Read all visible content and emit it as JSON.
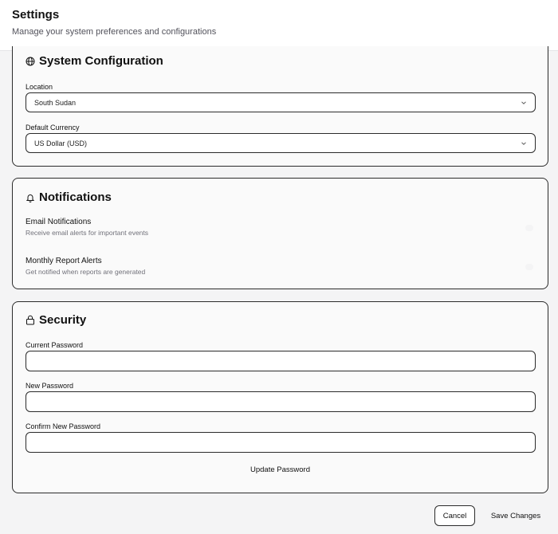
{
  "header": {
    "title": "Settings",
    "subtitle": "Manage your system preferences and configurations"
  },
  "system": {
    "heading": "System Configuration",
    "icon": "globe-icon",
    "location_label": "Location",
    "location_value": "South Sudan",
    "currency_label": "Default Currency",
    "currency_value": "US Dollar (USD)"
  },
  "notifications": {
    "heading": "Notifications",
    "icon": "bell-icon",
    "items": [
      {
        "title": "Email Notifications",
        "description": "Receive email alerts for important events"
      },
      {
        "title": "Monthly Report Alerts",
        "description": "Get notified when reports are generated"
      }
    ]
  },
  "security": {
    "heading": "Security",
    "icon": "lock-icon",
    "current_label": "Current Password",
    "new_label": "New Password",
    "confirm_label": "Confirm New Password",
    "update_label": "Update Password"
  },
  "footer": {
    "cancel_label": "Cancel",
    "save_label": "Save Changes"
  }
}
